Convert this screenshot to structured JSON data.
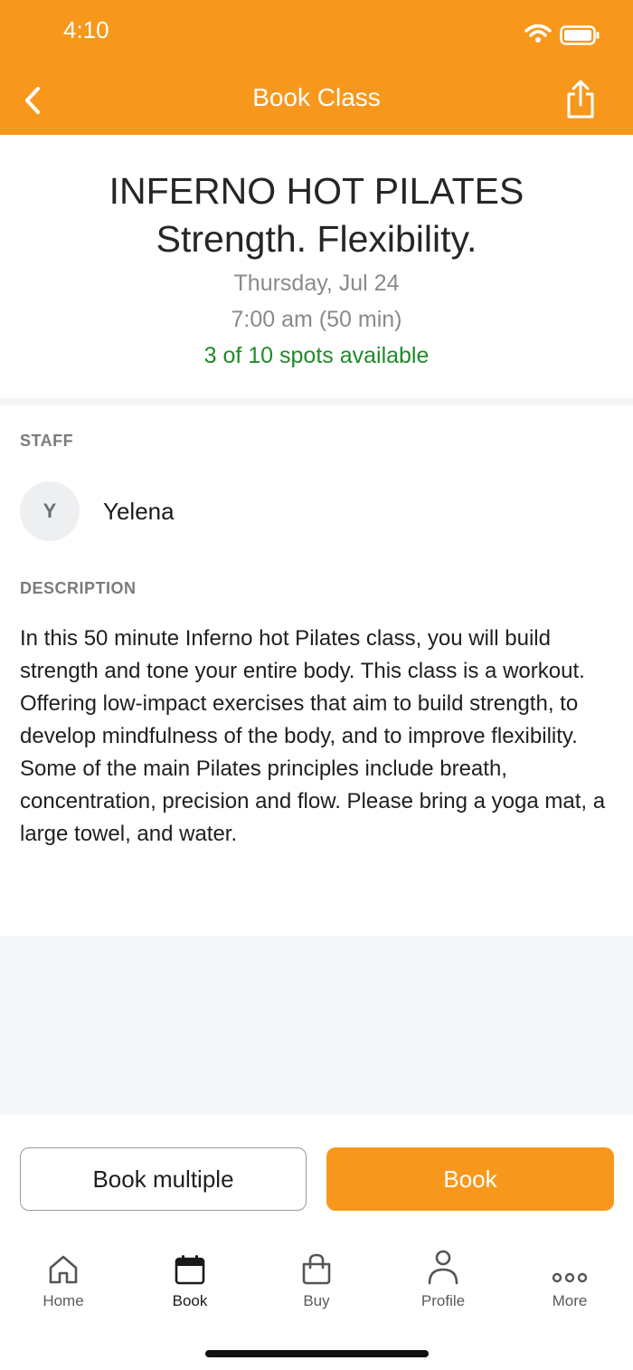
{
  "status_bar": {
    "time": "4:10"
  },
  "nav": {
    "title": "Book Class"
  },
  "class": {
    "title_line1": "INFERNO HOT PILATES",
    "title_line2": "Strength. Flexibility.",
    "date": "Thursday, Jul 24",
    "time": "7:00 am (50 min)",
    "availability": "3 of 10 spots available"
  },
  "staff": {
    "section_label": "STAFF",
    "avatar_initial": "Y",
    "name": "Yelena"
  },
  "description": {
    "section_label": "DESCRIPTION",
    "text": "In this 50 minute Inferno hot Pilates class, you will build strength and tone your entire body. This class is a workout. Offering low-impact exercises that aim to build strength, to develop mindfulness of the body, and to improve flexibility. Some of the main Pilates principles include breath, concentration, precision and flow. Please bring a yoga mat, a large towel, and water."
  },
  "actions": {
    "book_multiple_label": "Book multiple",
    "book_label": "Book"
  },
  "tabbar": {
    "items": [
      {
        "label": "Home",
        "icon": "home-icon"
      },
      {
        "label": "Book",
        "icon": "calendar-icon",
        "active": true
      },
      {
        "label": "Buy",
        "icon": "shopping-bag-icon"
      },
      {
        "label": "Profile",
        "icon": "person-icon"
      },
      {
        "label": "More",
        "icon": "more-dots-icon"
      }
    ]
  },
  "colors": {
    "brand": "#f7981d",
    "availability": "#1f8a2a"
  }
}
